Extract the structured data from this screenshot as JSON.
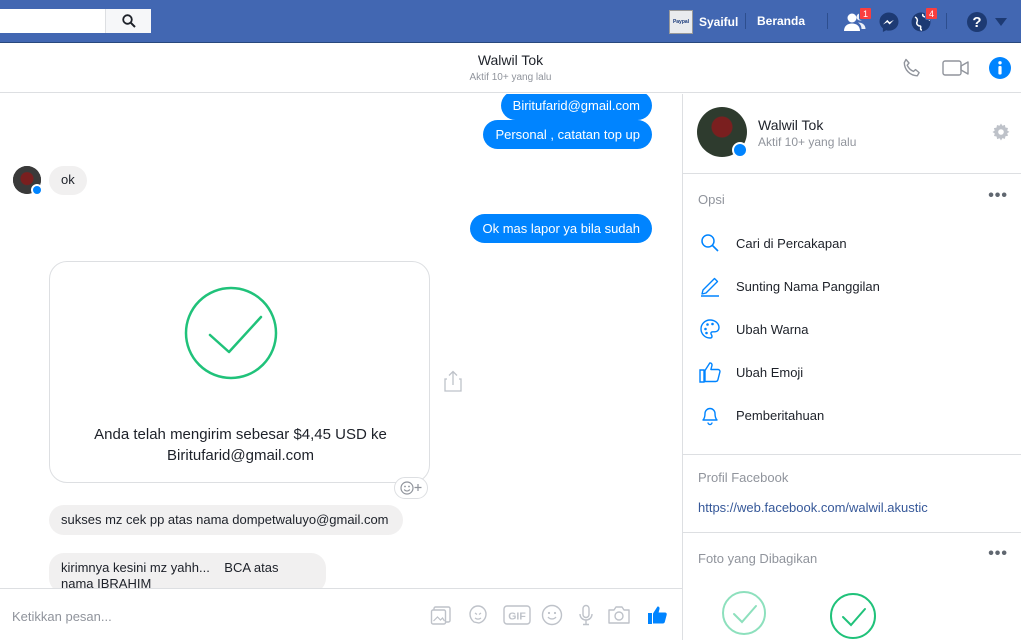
{
  "topbar": {
    "profile_name": "Syaiful",
    "avatar_text": "Paypal",
    "home_label": "Beranda",
    "friend_requests_count": "1",
    "notifications_count": "4"
  },
  "chat": {
    "contact_name": "Walwil Tok",
    "contact_status": "Aktif 10+ yang lalu"
  },
  "messages": [
    {
      "direction": "out",
      "text": "Biritufarid@gmail.com"
    },
    {
      "direction": "out",
      "text": "Personal , catatan top up"
    },
    {
      "direction": "in",
      "text": "ok"
    },
    {
      "direction": "out",
      "text": "Ok mas lapor ya bila sudah"
    },
    {
      "direction": "in",
      "type": "payment",
      "text": "Anda telah mengirim sebesar $4,45 USD ke Biritufarid@gmail.com"
    },
    {
      "direction": "in",
      "text": "sukses mz cek pp atas nama dompetwaluyo@gmail.com"
    },
    {
      "direction": "in",
      "text": "kirimnya kesini mz yahh...    BCA atas nama IBRAHIM"
    }
  ],
  "composer": {
    "placeholder": "Ketikkan pesan..."
  },
  "sidebar": {
    "contact_name": "Walwil Tok",
    "contact_status": "Aktif 10+ yang lalu",
    "options_title": "Opsi",
    "options": [
      {
        "label": "Cari di Percakapan",
        "icon": "search-icon"
      },
      {
        "label": "Sunting Nama Panggilan",
        "icon": "pencil-icon"
      },
      {
        "label": "Ubah Warna",
        "icon": "palette-icon"
      },
      {
        "label": "Ubah Emoji",
        "icon": "thumbs-up-icon"
      },
      {
        "label": "Pemberitahuan",
        "icon": "bell-icon"
      }
    ],
    "profile_title": "Profil Facebook",
    "profile_link": "https://web.facebook.com/walwil.akustic",
    "shared_photos_title": "Foto yang Dibagikan"
  },
  "colors": {
    "facebook_blue": "#4267b2",
    "messenger_blue": "#0084ff",
    "success_green": "#20c27a"
  }
}
